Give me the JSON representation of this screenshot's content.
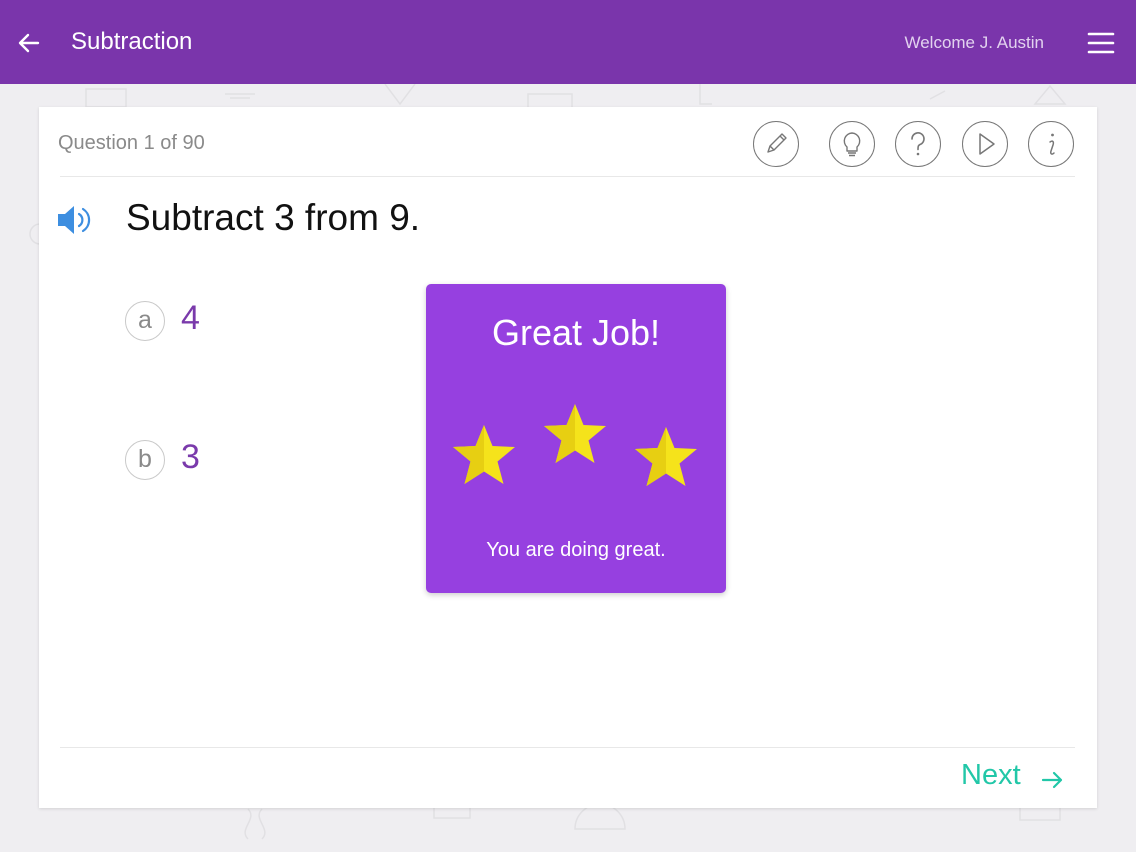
{
  "header": {
    "title": "Subtraction",
    "welcome": "Welcome J. Austin",
    "back_icon": "arrow-left-icon",
    "menu_icon": "hamburger-menu-icon",
    "background_color": "#7a35ab"
  },
  "question": {
    "counter": "Question 1 of 90",
    "text": "Subtract 3 from 9.",
    "speaker_icon": "speaker-icon"
  },
  "toolbar": {
    "icons": [
      "pencil-icon",
      "lightbulb-icon",
      "help-icon",
      "play-icon",
      "info-icon"
    ]
  },
  "options": [
    {
      "letter": "a",
      "value": "4"
    },
    {
      "letter": "b",
      "value": "3"
    }
  ],
  "popup": {
    "title": "Great Job!",
    "message": "You are doing great.",
    "stars": 3,
    "background_color": "#9640e0",
    "star_color": "#f5e31b"
  },
  "footer": {
    "next_label": "Next",
    "next_color": "#22c7a8"
  }
}
